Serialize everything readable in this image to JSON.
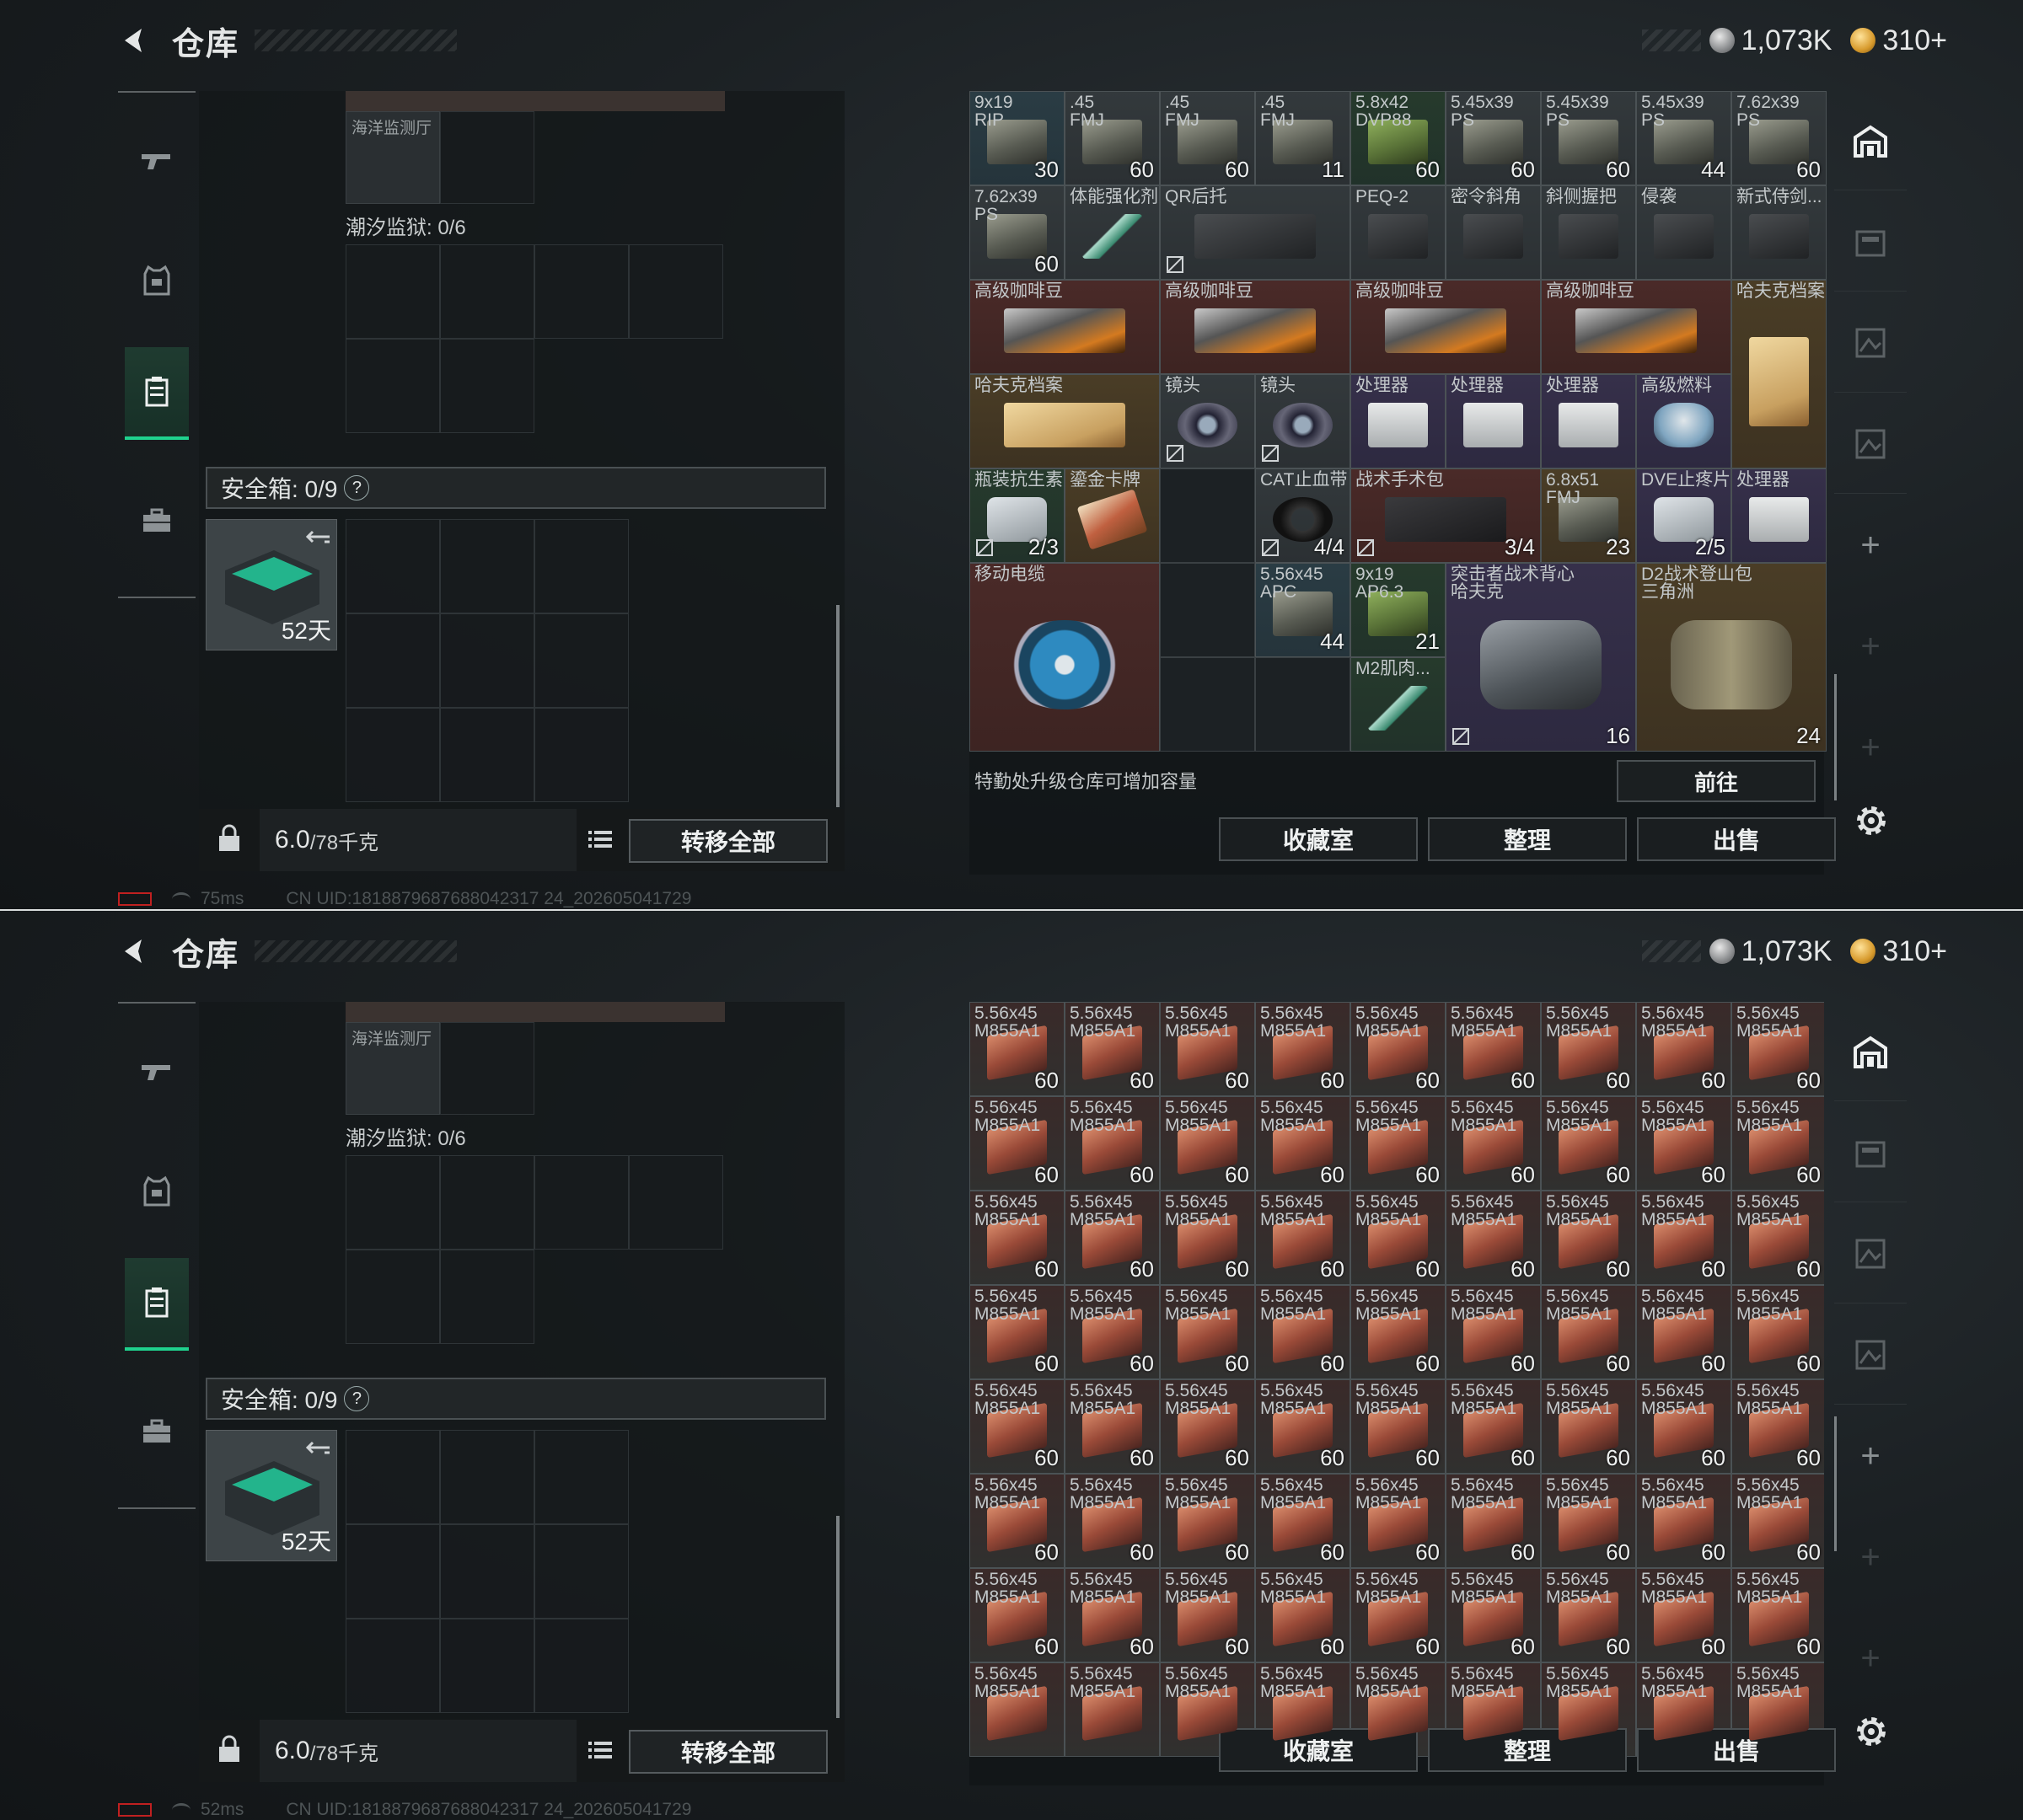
{
  "screens": [
    {
      "header": {
        "title": "仓库"
      },
      "currency": {
        "silver": "1,073K",
        "gold": "310+"
      },
      "left": {
        "container_item_label": "海洋监测厅",
        "container_label": "潮汐监狱: 0/6",
        "safe_label": "安全箱: 0/9",
        "safe_help": "?",
        "safe_days": "52天",
        "weight": "6.0",
        "weight_max": "/78千克",
        "transfer_all": "转移全部"
      },
      "stash_rows": [
        [
          {
            "name": "9x19\nRIP",
            "count": "30",
            "cls": "bg-blue",
            "pic": "ammo"
          },
          {
            "name": ".45\nFMJ",
            "count": "60",
            "cls": "bg-gray",
            "pic": "ammo"
          },
          {
            "name": ".45\nFMJ",
            "count": "60",
            "cls": "bg-gray",
            "pic": "ammo"
          },
          {
            "name": ".45\nFMJ",
            "count": "11",
            "cls": "bg-gray",
            "pic": "ammo"
          },
          {
            "name": "5.8x42\nDVP88",
            "count": "60",
            "cls": "bg-green",
            "pic": "green-ammo"
          },
          {
            "name": "5.45x39\nPS",
            "count": "60",
            "cls": "bg-gray",
            "pic": "ammo"
          },
          {
            "name": "5.45x39\nPS",
            "count": "60",
            "cls": "bg-gray",
            "pic": "ammo"
          },
          {
            "name": "5.45x39\nPS",
            "count": "44",
            "cls": "bg-gray",
            "pic": "ammo"
          },
          {
            "name": "7.62x39\nPS",
            "count": "60",
            "cls": "bg-gray",
            "pic": "ammo"
          }
        ],
        [
          {
            "name": "7.62x39\nPS",
            "count": "60",
            "cls": "bg-gray",
            "pic": "ammo"
          },
          {
            "name": "体能强化剂",
            "count": "",
            "cls": "bg-gray",
            "pic": "syringe"
          },
          {
            "name": "QR后托",
            "count": "",
            "cls": "bg-gray",
            "pic": "gun",
            "span": 2,
            "nolock": true
          },
          {
            "name": "PEQ-2",
            "count": "",
            "cls": "bg-gray",
            "pic": "gun"
          },
          {
            "name": "密令斜角",
            "count": "",
            "cls": "bg-gray",
            "pic": "gun"
          },
          {
            "name": "斜侧握把",
            "count": "",
            "cls": "bg-gray",
            "pic": "gun"
          },
          {
            "name": "侵袭",
            "count": "",
            "cls": "bg-gray",
            "pic": "gun"
          },
          {
            "name": "新式侍剑...",
            "count": "",
            "cls": "bg-gray",
            "pic": "gun"
          }
        ]
      ],
      "stash_rows_b": [
        {
          "name": "高级咖啡豆",
          "cls": "bg-red",
          "pic": "coffee",
          "span": 2,
          "row": 3,
          "col": 1
        },
        {
          "name": "高级咖啡豆",
          "cls": "bg-red",
          "pic": "coffee",
          "span": 2,
          "row": 3,
          "col": 3
        },
        {
          "name": "高级咖啡豆",
          "cls": "bg-red",
          "pic": "coffee",
          "span": 2,
          "row": 3,
          "col": 5
        },
        {
          "name": "高级咖啡豆",
          "cls": "bg-red",
          "pic": "coffee",
          "span": 2,
          "row": 3,
          "col": 7
        },
        {
          "name": "哈夫克档案",
          "cls": "bg-gold",
          "pic": "folder",
          "rspan": 2,
          "row": 3,
          "col": 9
        },
        {
          "name": "哈夫克档案",
          "cls": "bg-gold",
          "pic": "folder",
          "span": 2,
          "row": 4,
          "col": 1
        },
        {
          "name": "镜头",
          "cls": "bg-gray",
          "pic": "lens",
          "row": 4,
          "col": 3,
          "nolock": true
        },
        {
          "name": "镜头",
          "cls": "bg-gray",
          "pic": "lens",
          "row": 4,
          "col": 4,
          "nolock": true
        },
        {
          "name": "处理器",
          "cls": "bg-purple",
          "pic": "device",
          "row": 4,
          "col": 5
        },
        {
          "name": "处理器",
          "cls": "bg-purple",
          "pic": "device",
          "row": 4,
          "col": 6
        },
        {
          "name": "处理器",
          "cls": "bg-purple",
          "pic": "device",
          "row": 4,
          "col": 7
        },
        {
          "name": "高级燃料",
          "cls": "bg-purple",
          "pic": "fuel",
          "row": 4,
          "col": 8
        },
        {
          "name": "瓶装抗生素",
          "count": "2/3",
          "cls": "bg-green",
          "pic": "pill",
          "row": 5,
          "col": 1,
          "nolock": true
        },
        {
          "name": "鎏金卡牌",
          "cls": "bg-gold",
          "pic": "card",
          "row": 5,
          "col": 2
        },
        {
          "name": "CAT止血带",
          "count": "4/4",
          "cls": "bg-gray",
          "pic": "strap",
          "row": 5,
          "col": 4,
          "nolock": true
        },
        {
          "name": "战术手术包",
          "count": "3/4",
          "cls": "bg-red",
          "pic": "medkit",
          "span": 2,
          "row": 5,
          "col": 5,
          "nolock": true
        },
        {
          "name": "6.8x51\nFMJ",
          "count": "23",
          "cls": "bg-gold",
          "pic": "ammo",
          "row": 5,
          "col": 7
        },
        {
          "name": "DVE止疼片",
          "count": "2/5",
          "cls": "bg-purple",
          "pic": "pill",
          "row": 5,
          "col": 8
        },
        {
          "name": "处理器",
          "cls": "bg-purple",
          "pic": "device",
          "row": 5,
          "col": 9
        },
        {
          "name": "移动电缆",
          "cls": "bg-red",
          "pic": "reel",
          "span": 2,
          "rspan": 2,
          "row": 6,
          "col": 1
        },
        {
          "name": "5.56x45\nAPC",
          "count": "44",
          "cls": "bg-blue",
          "pic": "ammo",
          "row": 6,
          "col": 4
        },
        {
          "name": "9x19\nAP6.3",
          "count": "21",
          "cls": "bg-green",
          "pic": "green-ammo",
          "row": 6,
          "col": 5
        },
        {
          "name": "突击者战术背心\n哈夫克",
          "count": "16",
          "cls": "bg-purple",
          "pic": "vest",
          "span": 2,
          "rspan": 2,
          "row": 6,
          "col": 6,
          "nolock": true
        },
        {
          "name": "D2战术登山包\n三角洲",
          "count": "24",
          "cls": "bg-gold",
          "pic": "bag",
          "span": 2,
          "rspan": 2,
          "row": 6,
          "col": 8
        },
        {
          "name": "M2肌肉...",
          "cls": "bg-green",
          "pic": "syringe",
          "row": 7,
          "col": 5
        }
      ],
      "footer_note": "特勤处升级仓库可增加容量",
      "goto": "前往",
      "buttons": [
        "收藏室",
        "整理",
        "出售"
      ],
      "status": {
        "ping": "75ms",
        "uid": "CN UID:1818879687688042317 24_202605041729"
      }
    },
    {
      "header": {
        "title": "仓库"
      },
      "currency": {
        "silver": "1,073K",
        "gold": "310+"
      },
      "left": {
        "container_item_label": "海洋监测厅",
        "container_label": "潮汐监狱: 0/6",
        "safe_label": "安全箱: 0/9",
        "safe_help": "?",
        "safe_days": "52天",
        "weight": "6.0",
        "weight_max": "/78千克",
        "transfer_all": "转移全部"
      },
      "ammo_item": {
        "name": "5.56x45\nM855A1",
        "count": "60"
      },
      "ammo_rows": 8,
      "ammo_cols": 9,
      "buttons": [
        "收藏室",
        "整理",
        "出售"
      ],
      "status": {
        "ping": "52ms",
        "uid": "CN UID:1818879687688042317 24_202605041729"
      }
    }
  ],
  "colors": {
    "accent": "#1fd28e",
    "alert": "#c02020"
  }
}
